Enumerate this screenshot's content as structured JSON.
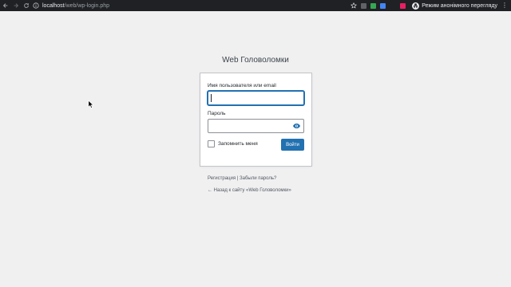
{
  "browser": {
    "url_host": "localhost",
    "url_path": "/web/wp-login.php",
    "incognito_label": "Режим анонімного перегляду"
  },
  "login": {
    "site_title": "Web Головоломки",
    "username_label": "Имя пользователя или email",
    "username_value": "",
    "password_label": "Пароль",
    "password_value": "",
    "remember_label": "Запомнить меня",
    "remember_checked": false,
    "submit_label": "Войти"
  },
  "footer": {
    "register_label": "Регистрация",
    "separator": "|",
    "lost_password_label": "Забыли пароль?",
    "back_label": "← Назад к сайту «Web Головоломки»"
  },
  "colors": {
    "accent": "#2271b1",
    "page_bg": "#f0f0f1",
    "chrome_bg": "#202124"
  }
}
